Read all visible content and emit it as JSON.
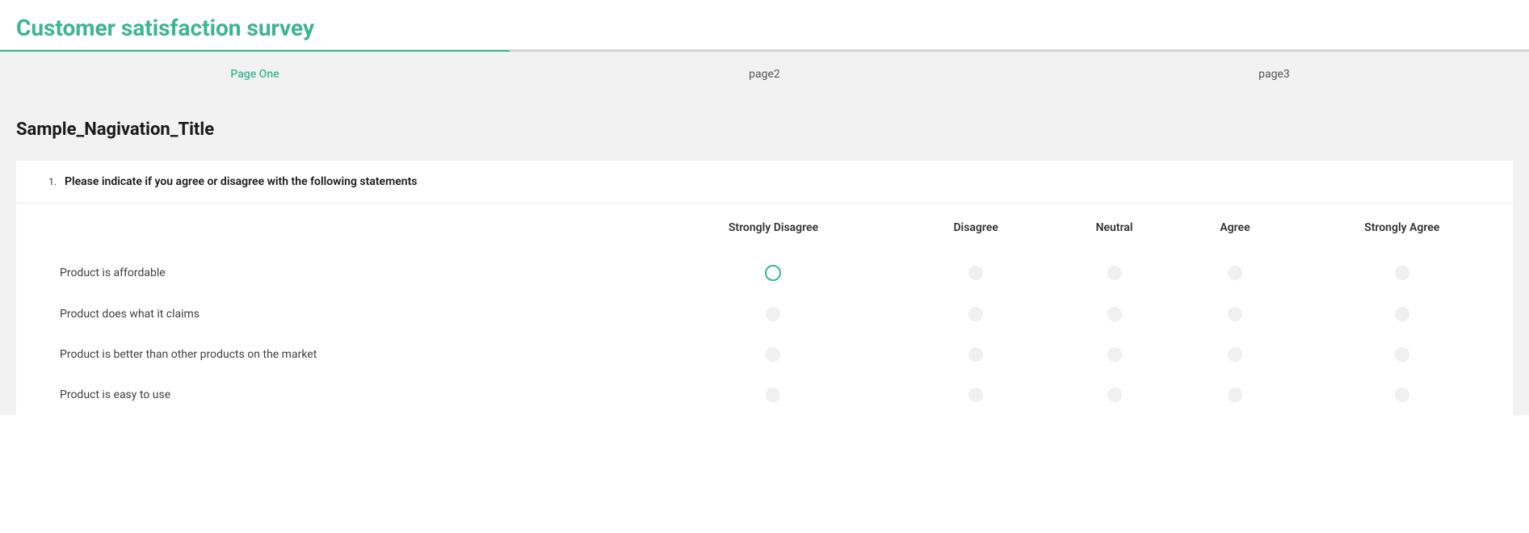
{
  "survey": {
    "title": "Customer satisfaction survey"
  },
  "pages": [
    {
      "label": "Page One",
      "active": true
    },
    {
      "label": "page2",
      "active": false
    },
    {
      "label": "page3",
      "active": false
    }
  ],
  "nav_title": "Sample_Nagivation_Title",
  "question": {
    "number": "1.",
    "text": "Please indicate if you agree or disagree with the following statements",
    "columns": [
      "Strongly Disagree",
      "Disagree",
      "Neutral",
      "Agree",
      "Strongly Agree"
    ],
    "rows": [
      "Product is affordable",
      "Product does what it claims",
      "Product is better than other products on the market",
      "Product is easy to use"
    ],
    "focused_cell": {
      "row": 0,
      "col": 0
    }
  }
}
